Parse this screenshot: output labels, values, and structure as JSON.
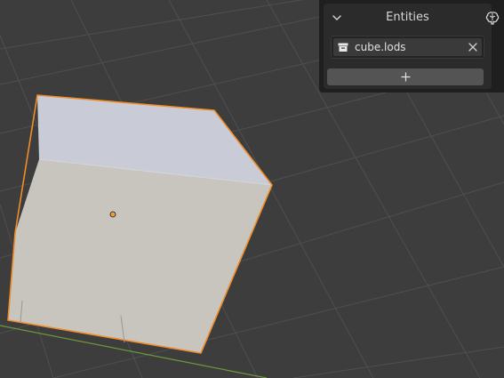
{
  "viewport": {
    "background_color": "#3d3d3d",
    "grid_color": "#4f4f4f",
    "x_axis_color": "#6a9a3a",
    "object": {
      "kind": "cube",
      "selected_outline_color": "#f08d2a",
      "origin_color": "#f0a030",
      "top_face_color": "#c9ccd6",
      "front_face_color": "#c8c5bf"
    }
  },
  "entities_panel": {
    "title": "Entities",
    "collapse_icon": "chevron-down-icon",
    "header_icon": "brain-icon",
    "items": [
      {
        "label": "cube.lods",
        "icon": "archive-icon",
        "remove_icon": "close-icon"
      }
    ],
    "add_icon": "plus-icon"
  }
}
